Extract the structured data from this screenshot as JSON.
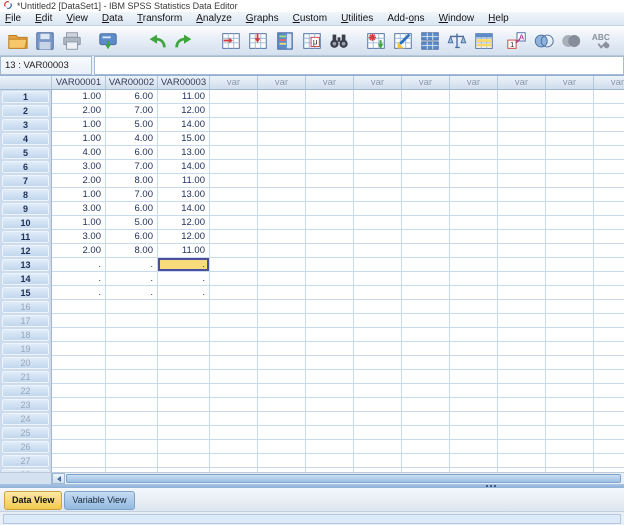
{
  "window": {
    "title": "*Untitled2 [DataSet1] - IBM SPSS Statistics Data Editor"
  },
  "menu": {
    "items": [
      {
        "label": "File",
        "mnemonic": "F"
      },
      {
        "label": "Edit",
        "mnemonic": "E"
      },
      {
        "label": "View",
        "mnemonic": "V"
      },
      {
        "label": "Data",
        "mnemonic": "D"
      },
      {
        "label": "Transform",
        "mnemonic": "T"
      },
      {
        "label": "Analyze",
        "mnemonic": "A"
      },
      {
        "label": "Graphs",
        "mnemonic": "G"
      },
      {
        "label": "Custom",
        "mnemonic": "C"
      },
      {
        "label": "Utilities",
        "mnemonic": "U"
      },
      {
        "label": "Add-ons",
        "mnemonic": "o"
      },
      {
        "label": "Window",
        "mnemonic": "W"
      },
      {
        "label": "Help",
        "mnemonic": "H"
      }
    ]
  },
  "toolbar": {
    "icons": [
      "open-data",
      "save",
      "print",
      "recall-dialogs",
      "undo",
      "redo",
      "goto-case",
      "goto-variable",
      "variables",
      "variable-properties",
      "find",
      "insert-cases",
      "insert-variable",
      "split-file",
      "weight-cases",
      "select-cases",
      "value-labels",
      "use-variable-sets",
      "show-all-variables",
      "spell-check"
    ]
  },
  "cell_reference": {
    "value": "13 : VAR00003",
    "editor_value": ""
  },
  "grid": {
    "columns": [
      "VAR00001",
      "VAR00002",
      "VAR00003"
    ],
    "var_column_label": "var",
    "var_column_count": 9,
    "total_visible_rows": 28,
    "selected": {
      "row": 13,
      "column": "VAR00003"
    },
    "rows": [
      {
        "n": 1,
        "values": [
          "1.00",
          "6.00",
          "11.00"
        ]
      },
      {
        "n": 2,
        "values": [
          "2.00",
          "7.00",
          "12.00"
        ]
      },
      {
        "n": 3,
        "values": [
          "1.00",
          "5.00",
          "14.00"
        ]
      },
      {
        "n": 4,
        "values": [
          "1.00",
          "4.00",
          "15.00"
        ]
      },
      {
        "n": 5,
        "values": [
          "4.00",
          "6.00",
          "13.00"
        ]
      },
      {
        "n": 6,
        "values": [
          "3.00",
          "7.00",
          "14.00"
        ]
      },
      {
        "n": 7,
        "values": [
          "2.00",
          "8.00",
          "11.00"
        ]
      },
      {
        "n": 8,
        "values": [
          "1.00",
          "7.00",
          "13.00"
        ]
      },
      {
        "n": 9,
        "values": [
          "3.00",
          "6.00",
          "14.00"
        ]
      },
      {
        "n": 10,
        "values": [
          "1.00",
          "5.00",
          "12.00"
        ]
      },
      {
        "n": 11,
        "values": [
          "3.00",
          "6.00",
          "12.00"
        ]
      },
      {
        "n": 12,
        "values": [
          "2.00",
          "8.00",
          "11.00"
        ]
      },
      {
        "n": 13,
        "values": [
          ".",
          ".",
          "."
        ]
      },
      {
        "n": 14,
        "values": [
          ".",
          ".",
          "."
        ]
      },
      {
        "n": 15,
        "values": [
          ".",
          ".",
          "."
        ]
      }
    ]
  },
  "tabs": {
    "data_view_label": "Data View",
    "variable_view_label": "Variable View",
    "active": "Data View"
  },
  "status_bar": {
    "text": ""
  },
  "colors": {
    "selected_cell_fill": "#F8DC7C",
    "selected_cell_border": "#4B4E9E",
    "active_tab_fill": "#F2C94C",
    "inactive_tab_fill": "#92B8DF",
    "grid_line": "#C7DAEE",
    "header_text": "#333B58",
    "var_header_text": "#8A99AE",
    "data_text": "#21315B"
  }
}
